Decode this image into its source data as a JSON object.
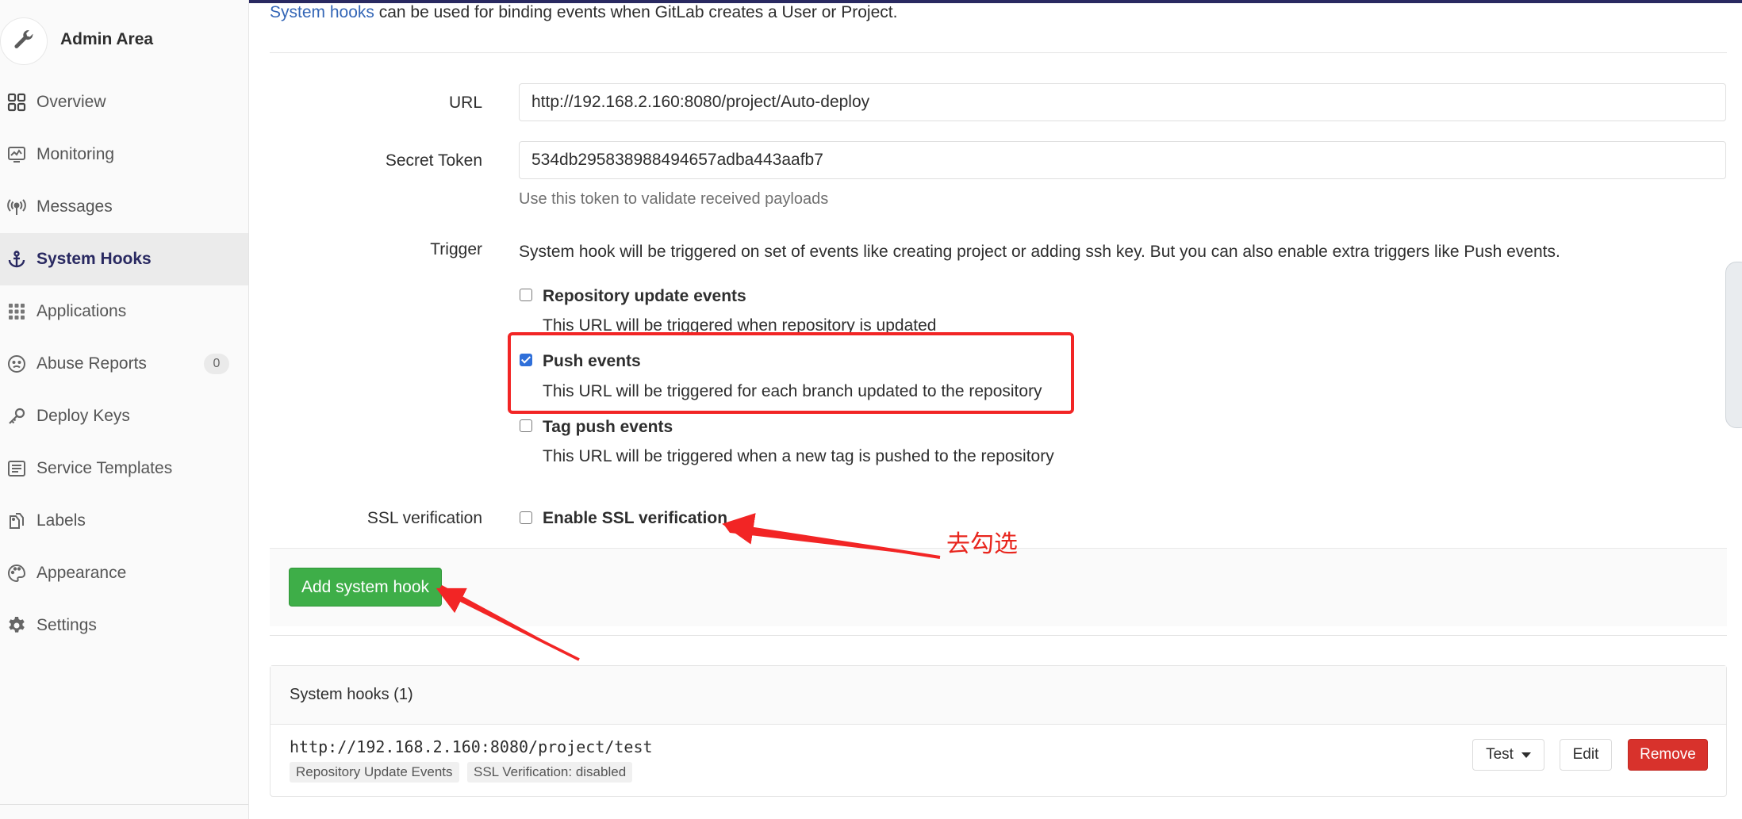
{
  "colors": {
    "accent_nav": "#292961",
    "link": "#3567b7",
    "success": "#3eae48",
    "danger": "#d8322c",
    "annotation": "#f22525"
  },
  "sidebar": {
    "title": "Admin Area",
    "items": [
      {
        "label": "Overview",
        "icon": "grid-icon"
      },
      {
        "label": "Monitoring",
        "icon": "monitor-icon"
      },
      {
        "label": "Messages",
        "icon": "broadcast-icon"
      },
      {
        "label": "System Hooks",
        "icon": "anchor-icon",
        "active": true
      },
      {
        "label": "Applications",
        "icon": "apps-icon"
      },
      {
        "label": "Abuse Reports",
        "icon": "abuse-icon",
        "badge": "0"
      },
      {
        "label": "Deploy Keys",
        "icon": "key-icon"
      },
      {
        "label": "Service Templates",
        "icon": "template-icon"
      },
      {
        "label": "Labels",
        "icon": "labels-icon"
      },
      {
        "label": "Appearance",
        "icon": "palette-icon"
      },
      {
        "label": "Settings",
        "icon": "gear-icon"
      }
    ]
  },
  "intro": {
    "link": "System hooks",
    "text": " can be used for binding events when GitLab creates a User or Project."
  },
  "form": {
    "url_label": "URL",
    "url_value": "http://192.168.2.160:8080/project/Auto-deploy",
    "token_label": "Secret Token",
    "token_value": "534db295838988494657adba443aafb7",
    "token_help": "Use this token to validate received payloads",
    "trigger_label": "Trigger",
    "trigger_text": "System hook will be triggered on set of events like creating project or adding ssh key. But you can also enable extra triggers like Push events.",
    "options": [
      {
        "title": "Repository update events",
        "desc": "This URL will be triggered when repository is updated",
        "checked": false
      },
      {
        "title": "Push events",
        "desc": "This URL will be triggered for each branch updated to the repository",
        "checked": true
      },
      {
        "title": "Tag push events",
        "desc": "This URL will be triggered when a new tag is pushed to the repository",
        "checked": false
      }
    ],
    "ssl_label": "SSL verification",
    "ssl_option": "Enable SSL verification",
    "ssl_checked": false,
    "submit": "Add system hook"
  },
  "annotation": {
    "text": "去勾选"
  },
  "hooks": {
    "title": "System hooks (1)",
    "items": [
      {
        "url": "http://192.168.2.160:8080/project/test",
        "tags": [
          "Repository Update Events",
          "SSL Verification: disabled"
        ],
        "test_label": "Test",
        "edit_label": "Edit",
        "remove_label": "Remove"
      }
    ]
  }
}
